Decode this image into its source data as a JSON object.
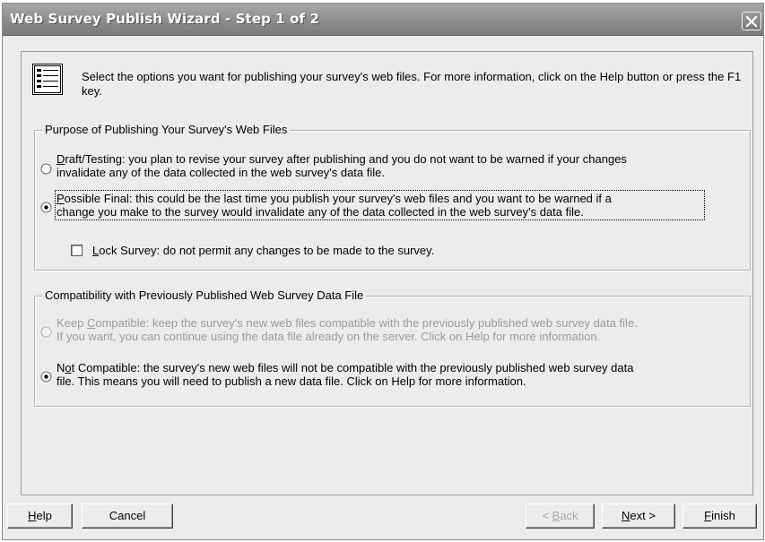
{
  "window": {
    "title": "Web Survey Publish Wizard - Step 1 of 2"
  },
  "intro": {
    "icon": "form-icon",
    "text": "Select the options you want for publishing your survey's web files. For more information, click on the Help button or press the F1 key."
  },
  "purpose_group": {
    "legend": "Purpose of Publishing Your Survey's Web Files",
    "options": [
      {
        "mnemonic": "D",
        "rest_line1": "raft/Testing: you plan to revise your survey after publishing and you do not want to be warned if your changes",
        "line2": "invalidate any of the data collected in the web survey's data file.",
        "selected": false
      },
      {
        "mnemonic": "P",
        "rest_line1": "ossible Final: this could be the last time you publish your survey's web files and you want to be warned if a",
        "line2": "change you make to the survey would invalidate any of the data collected in the web survey's data file.",
        "selected": true
      }
    ],
    "lock_checkbox": {
      "mnemonic": "L",
      "rest": "ock Survey: do not permit any changes to be made to the survey.",
      "checked": false
    }
  },
  "compat_group": {
    "legend": "Compatibility with Previously Published Web Survey Data File",
    "options": [
      {
        "pre": "Keep ",
        "mnemonic": "C",
        "rest_line1": "ompatible: keep the survey's new web files compatible with the previously published web survey data file.",
        "line2": "If you want, you can continue using the data file already on the server. Click on Help for more information.",
        "selected": false,
        "disabled": true
      },
      {
        "pre": "N",
        "mnemonic": "o",
        "rest_line1": "t Compatible: the survey's new web files will not be compatible with the previously published web survey data",
        "line2": "file. This means you will need to publish a new data file. Click on Help for more information.",
        "selected": true,
        "disabled": false
      }
    ]
  },
  "buttons": {
    "help": {
      "mnemonic": "H",
      "rest": "elp"
    },
    "cancel": {
      "label": "Cancel"
    },
    "back": {
      "pre": "< ",
      "mnemonic": "B",
      "rest": "ack",
      "disabled": true
    },
    "next": {
      "mnemonic": "N",
      "rest": "ext >"
    },
    "finish": {
      "mnemonic": "F",
      "rest": "inish"
    }
  }
}
